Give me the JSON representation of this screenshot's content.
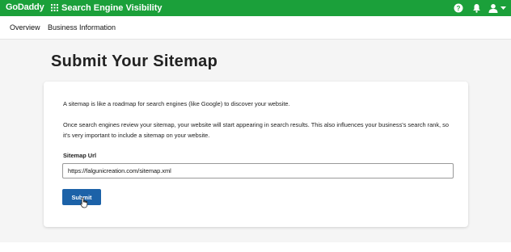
{
  "topbar": {
    "brand": "GoDaddy",
    "app_title": "Search Engine Visibility",
    "icons": [
      "apps-grid-icon",
      "help-icon",
      "bell-icon",
      "user-icon",
      "caret-down-icon"
    ]
  },
  "subnav": {
    "overview": "Overview",
    "business_info": "Business Information"
  },
  "page": {
    "title": "Submit Your Sitemap"
  },
  "card": {
    "para1": "A sitemap is like a roadmap for search engines (like Google) to discover your website.",
    "para2": "Once search engines review your sitemap, your website will start appearing in search results. This also influences your business's search rank, so it's very important to include a sitemap on your website.",
    "field_label": "Sitemap Url",
    "field_value": "https://falgunicreation.com/sitemap.xml",
    "submit_label": "Submit"
  },
  "colors": {
    "brand_green": "#1ba03a",
    "button_blue": "#1c62a8",
    "page_bg": "#f5f5f5"
  }
}
